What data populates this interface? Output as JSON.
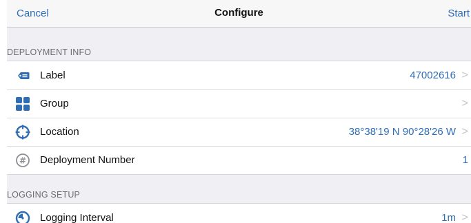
{
  "nav": {
    "cancel_label": "Cancel",
    "title": "Configure",
    "start_label": "Start"
  },
  "sections": {
    "deployment": {
      "header": "DEPLOYMENT INFO",
      "rows": {
        "label": {
          "label": "Label",
          "value": "47002616",
          "icon": "tag-icon"
        },
        "group": {
          "label": "Group",
          "value": "",
          "icon": "grid-icon"
        },
        "location": {
          "label": "Location",
          "value": "38°38'19 N 90°28'26 W",
          "icon": "crosshair-icon"
        },
        "deployment_number": {
          "label": "Deployment Number",
          "value": "1",
          "icon": "number-badge-icon"
        }
      }
    },
    "logging": {
      "header": "LOGGING SETUP",
      "rows": {
        "interval": {
          "label": "Logging Interval",
          "value": "1m",
          "icon": "interval-gauge-icon"
        }
      }
    }
  },
  "colors": {
    "accent": "#2f6db5",
    "background": "#efeff4",
    "section_header_text": "#6d6d72",
    "chevron": "#c7c7cc"
  }
}
